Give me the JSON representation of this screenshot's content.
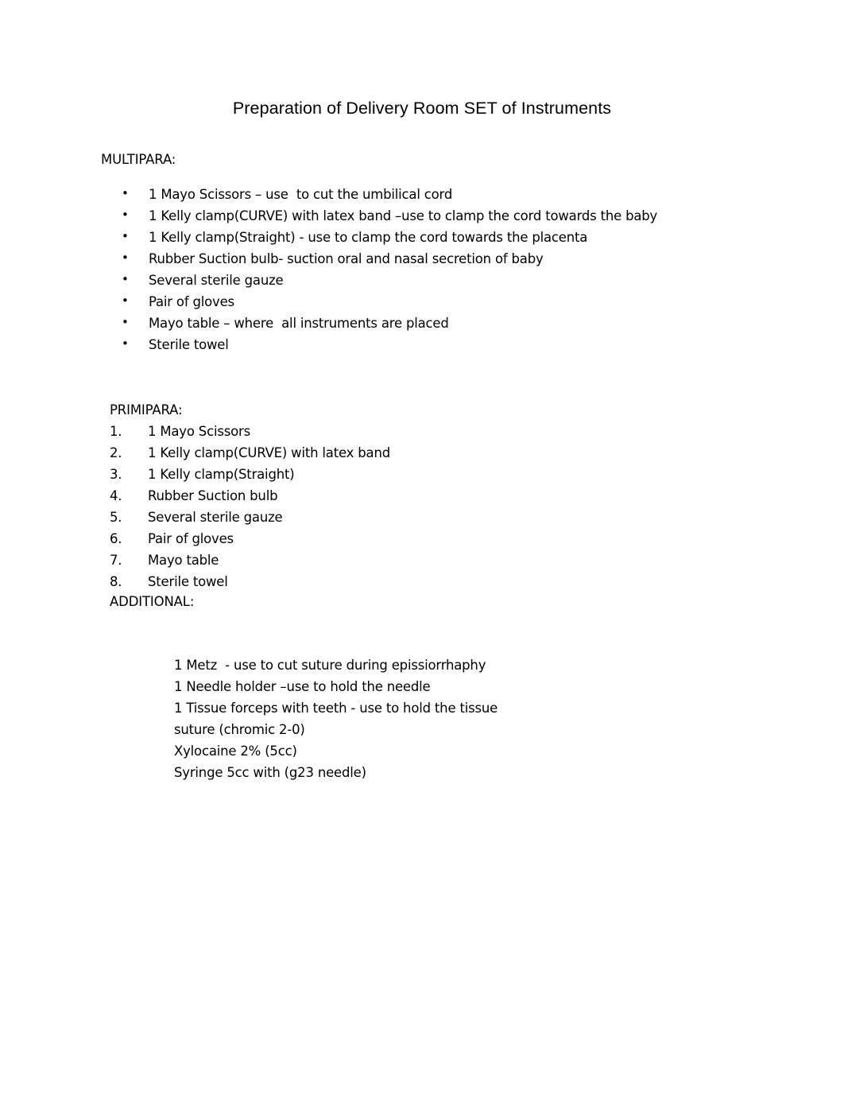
{
  "document": {
    "title": "Preparation of Delivery Room SET of Instruments",
    "background_color": "#ffffff",
    "text_color": "#000000"
  },
  "sections": {
    "multipara": {
      "heading": "MULTIPARA:",
      "marker": "bullet",
      "items": [
        "1 Mayo Scissors – use  to cut the umbilical cord",
        "1 Kelly clamp(CURVE) with latex band –use to clamp the cord towards the baby",
        "1 Kelly clamp(Straight) - use to clamp the cord towards the placenta",
        "Rubber Suction bulb- suction oral and nasal secretion of baby",
        "Several sterile gauze",
        "Pair of gloves",
        "Mayo table – where  all instruments are placed",
        "Sterile towel"
      ]
    },
    "primipara": {
      "heading": "PRIMIPARA:",
      "marker": "numbered",
      "numbers": [
        "1.",
        "2.",
        "3.",
        "4.",
        "5.",
        "6.",
        "7.",
        "8."
      ],
      "items": [
        "1 Mayo Scissors",
        "1 Kelly clamp(CURVE) with latex band",
        "1 Kelly clamp(Straight)",
        "Rubber Suction bulb",
        "Several sterile gauze",
        "Pair of gloves",
        "Mayo table",
        "Sterile towel"
      ]
    },
    "additional": {
      "heading": "ADDITIONAL:",
      "marker": "none",
      "items": [
        "1 Metz  - use to cut suture during epissiorrhaphy",
        "1 Needle holder –use to hold the needle",
        "1 Tissue forceps with teeth - use to hold the tissue",
        "suture (chromic 2-0)",
        "Xylocaine 2% (5cc)",
        "Syringe 5cc with (g23 needle)"
      ]
    }
  },
  "glyphs": {
    "bullet": "•"
  }
}
